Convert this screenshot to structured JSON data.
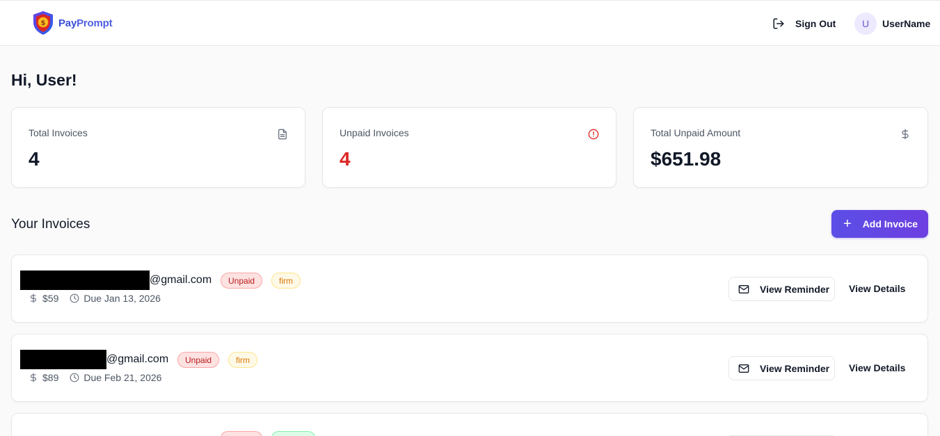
{
  "header": {
    "brand_part1": "Pay",
    "brand_part2": "Prompt",
    "sign_out_label": "Sign Out",
    "avatar_initial": "U",
    "username": "UserName"
  },
  "greeting": "Hi, User!",
  "stats": [
    {
      "label": "Total Invoices",
      "value": "4",
      "icon": "document-icon"
    },
    {
      "label": "Unpaid Invoices",
      "value": "4",
      "icon": "alert-circle-icon"
    },
    {
      "label": "Total Unpaid Amount",
      "value": "$651.98",
      "icon": "dollar-icon"
    }
  ],
  "section": {
    "title": "Your Invoices",
    "add_button_label": "Add Invoice"
  },
  "invoices": [
    {
      "email_domain": "@gmail.com",
      "status": "Unpaid",
      "tone": "firm",
      "amount": "$59",
      "due": "Due Jan 13, 2026",
      "reminder_label": "View Reminder",
      "details_label": "View Details"
    },
    {
      "email_domain": "@gmail.com",
      "status": "Unpaid",
      "tone": "firm",
      "amount": "$89",
      "due": "Due Feb 21, 2026",
      "reminder_label": "View Reminder",
      "details_label": "View Details"
    }
  ],
  "colors": {
    "accent": "#5b4ee6",
    "unpaid_red": "#dc2626",
    "firm_amber": "#d97706"
  }
}
